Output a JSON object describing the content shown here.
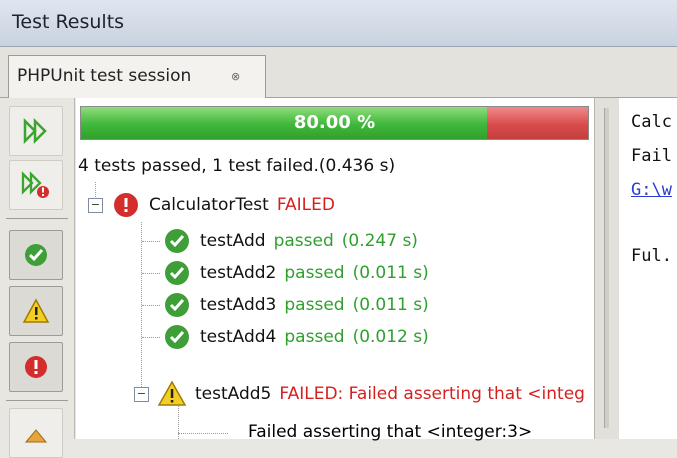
{
  "window": {
    "title": "Test Results"
  },
  "tab": {
    "label": "PHPUnit test session",
    "close": "⊗"
  },
  "progress": {
    "text": "80.00 %",
    "fraction": 0.8
  },
  "summary": "4 tests passed, 1 test failed.(0.436 s)",
  "suite": {
    "name": "CalculatorTest",
    "status": "FAILED"
  },
  "tests": [
    {
      "name": "testAdd",
      "status": "passed",
      "time": "(0.247 s)"
    },
    {
      "name": "testAdd2",
      "status": "passed",
      "time": "(0.011 s)"
    },
    {
      "name": "testAdd3",
      "status": "passed",
      "time": "(0.011 s)"
    },
    {
      "name": "testAdd4",
      "status": "passed",
      "time": "(0.012 s)"
    }
  ],
  "failed_test": {
    "name": "testAdd5",
    "status": "FAILED: Failed asserting that <integ",
    "detail": "Failed asserting that <integer:3>"
  },
  "output": {
    "line1": "Calc",
    "line2": "Fail",
    "line3": "G:\\w",
    "line4": "Ful."
  },
  "colors": {
    "pass": "#2fa02f",
    "fail": "#d52020",
    "progress_green": "#3fb83a",
    "progress_red": "#d94c4c"
  }
}
